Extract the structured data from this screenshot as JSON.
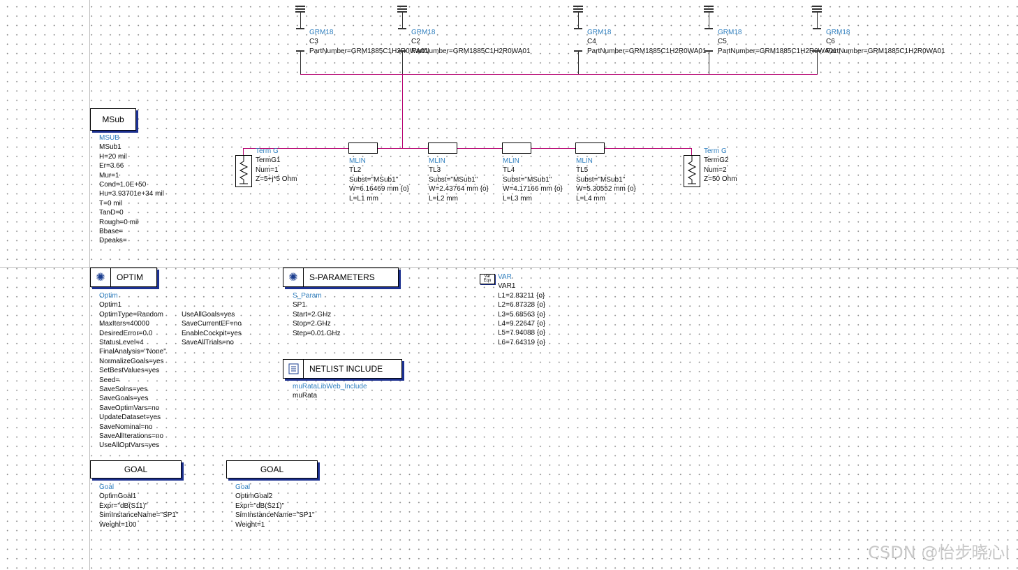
{
  "msub": {
    "title": "MSub",
    "lines": [
      "MSUB",
      "MSub1",
      "H=20 mil",
      "Er=3.66",
      "Mur=1",
      "Cond=1.0E+50",
      "Hu=3.93701e+34 mil",
      "T=0 mil",
      "TanD=0",
      "Rough=0 mil",
      "Bbase=",
      "Dpeaks="
    ]
  },
  "capacitors": [
    {
      "lines": [
        "GRM18",
        "C3",
        "PartNumber=GRM1885C1H2R0WA01"
      ]
    },
    {
      "lines": [
        "GRM18",
        "C2",
        "PartNumber=GRM1885C1H2R0WA01"
      ]
    },
    {
      "lines": [
        "GRM18",
        "C4",
        "PartNumber=GRM1885C1H2R0WA01"
      ]
    },
    {
      "lines": [
        "GRM18",
        "C5",
        "PartNumber=GRM1885C1H2R0WA01"
      ]
    },
    {
      "lines": [
        "GRM18",
        "C6",
        "PartNumber=GRM1885C1H2R0WA01"
      ]
    }
  ],
  "term1": {
    "lines": [
      "Term G",
      "TermG1",
      "Num=1",
      "Z=5+j*5 Ohm"
    ]
  },
  "term2": {
    "lines": [
      "Term G",
      "TermG2",
      "Num=2",
      "Z=50 Ohm"
    ]
  },
  "tlines": [
    {
      "lines": [
        "MLIN",
        "TL2",
        "Subst=\"MSub1\"",
        "W=6.16469 mm {o}",
        "L=L1 mm"
      ]
    },
    {
      "lines": [
        "MLIN",
        "TL3",
        "Subst=\"MSub1\"",
        "W=2.43764 mm {o}",
        "L=L2 mm"
      ]
    },
    {
      "lines": [
        "MLIN",
        "TL4",
        "Subst=\"MSub1\"",
        "W=4.17166 mm {o}",
        "L=L3 mm"
      ]
    },
    {
      "lines": [
        "MLIN",
        "TL5",
        "Subst=\"MSub1\"",
        "W=5.30552 mm {o}",
        "L=L4 mm"
      ]
    }
  ],
  "optim": {
    "title": "OPTIM",
    "col1": [
      "Optim",
      "Optim1",
      "OptimType=Random",
      "MaxIters=40000",
      "DesiredError=0.0",
      "StatusLevel=4",
      "FinalAnalysis=\"None\"",
      "NormalizeGoals=yes",
      "SetBestValues=yes",
      "Seed=",
      "SaveSolns=yes",
      "SaveGoals=yes",
      "SaveOptimVars=no",
      "UpdateDataset=yes",
      "SaveNominal=no",
      "SaveAllIterations=no",
      "UseAllOptVars=yes"
    ],
    "col2": [
      "UseAllGoals=yes",
      "SaveCurrentEF=no",
      "EnableCockpit=yes",
      "SaveAllTrials=no"
    ]
  },
  "sparam": {
    "title": "S-PARAMETERS",
    "lines": [
      "S_Param",
      "SP1",
      "Start=2 GHz",
      "Stop=2 GHz",
      "Step=0.01 GHz"
    ]
  },
  "netlist": {
    "title": "NETLIST INCLUDE",
    "lines": [
      "muRataLibWeb_Include",
      "muRata"
    ]
  },
  "var": {
    "icon_text": "Var Eqn",
    "lines": [
      "VAR",
      "VAR1",
      "L1=2.83211 {o}",
      "L2=6.87328 {o}",
      "L3=5.68563 {o}",
      "L4=9.22647 {o}",
      "L5=7.94088 {o}",
      "L6=7.64319 {o}"
    ]
  },
  "goals": [
    {
      "title": "GOAL",
      "lines": [
        "Goal",
        "OptimGoal1",
        "Expr=\"dB(S11)\"",
        "SimInstanceName=\"SP1\"",
        "Weight=100"
      ]
    },
    {
      "title": "GOAL",
      "lines": [
        "Goal",
        "OptimGoal2",
        "Expr=\"dB(S21)\"",
        "SimInstanceName=\"SP1\"",
        "Weight=1"
      ]
    }
  ],
  "watermark": "CSDN @怡步晓心l"
}
